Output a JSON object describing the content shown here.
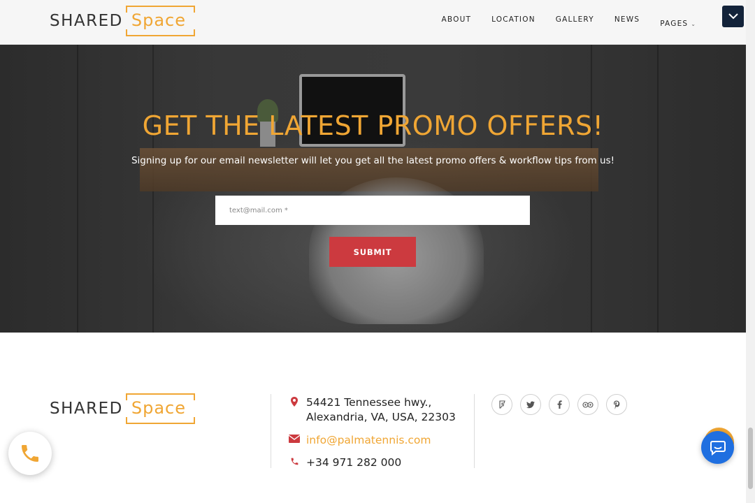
{
  "brand": {
    "word1": "SHARED",
    "word2": "Space"
  },
  "nav": {
    "items": [
      {
        "label": "ABOUT"
      },
      {
        "label": "LOCATION"
      },
      {
        "label": "GALLERY"
      },
      {
        "label": "NEWS"
      },
      {
        "label": "PAGES",
        "has_dropdown": true
      }
    ]
  },
  "newsletter": {
    "title": "GET THE LATEST PROMO OFFERS!",
    "subtitle": "Signing up for our email newsletter will let you get all the latest promo offers & workflow tips from us!",
    "email_placeholder": "text@mail.com *",
    "submit_label": "SUBMIT"
  },
  "footer": {
    "address_line1": "54421 Tennessee hwy.,",
    "address_line2": "Alexandria, VA, USA, 22303",
    "email": "info@palmatennis.com",
    "phone": "+34 971 282 000",
    "socials": [
      "foursquare-icon",
      "twitter-icon",
      "facebook-icon",
      "tripadvisor-icon",
      "pinterest-icon"
    ]
  },
  "colors": {
    "accent": "#f0a634",
    "submit": "#cc3a3f",
    "nav_toggle": "#13233a",
    "chat": "#1f6fe0",
    "icon_red": "#cc3a3f"
  }
}
